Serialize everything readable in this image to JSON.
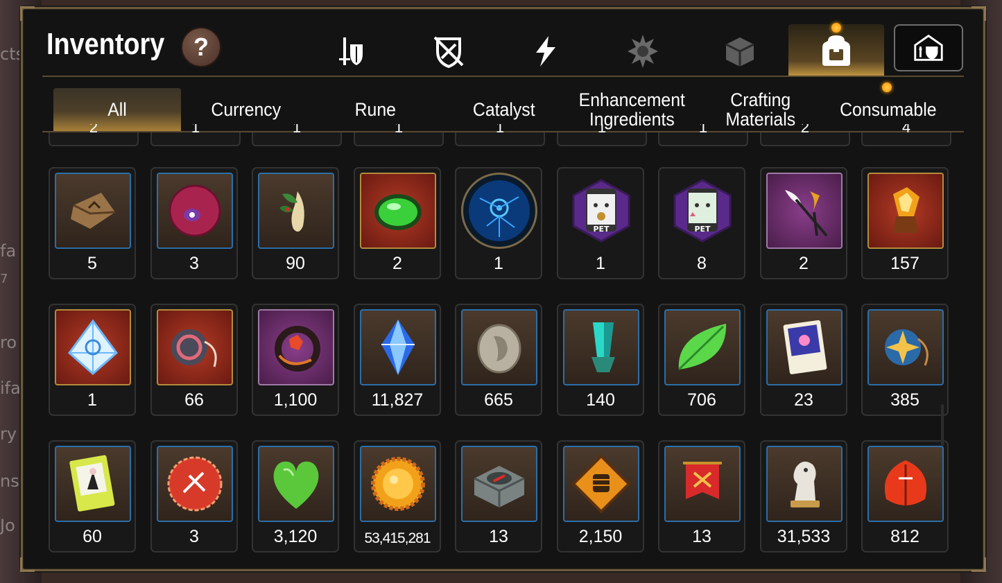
{
  "header": {
    "title": "Inventory",
    "help_label": "?"
  },
  "category_tabs": [
    {
      "icon": "sword-shield-icon",
      "active": false
    },
    {
      "icon": "broken-shield-icon",
      "active": false
    },
    {
      "icon": "lightning-icon",
      "active": false
    },
    {
      "icon": "spiked-artifact-icon",
      "active": false
    },
    {
      "icon": "cube-icon",
      "active": false
    },
    {
      "icon": "backpack-icon",
      "active": true
    }
  ],
  "guild_button_icon": "guild-storage-icon",
  "sub_tabs": [
    {
      "label": "All",
      "active": true
    },
    {
      "label": "Currency",
      "active": false
    },
    {
      "label": "Rune",
      "active": false
    },
    {
      "label": "Catalyst",
      "active": false
    },
    {
      "label": "Enhancement Ingredients",
      "active": false
    },
    {
      "label": "Crafting Materials",
      "active": false
    },
    {
      "label": "Consumable",
      "active": false
    }
  ],
  "items": [
    [
      {
        "icon": "pouch-icon",
        "qty": "5"
      },
      {
        "icon": "purple-eye-orb-icon",
        "qty": "3"
      },
      {
        "icon": "ginseng-root-icon",
        "qty": "90"
      },
      {
        "icon": "green-potion-icon",
        "qty": "2"
      },
      {
        "icon": "blue-portal-icon",
        "qty": "1"
      },
      {
        "icon": "pet-pack-cat-icon",
        "qty": "1"
      },
      {
        "icon": "pet-pack-icon",
        "qty": "8"
      },
      {
        "icon": "feather-wand-icon",
        "qty": "2"
      },
      {
        "icon": "flame-crystal-icon",
        "qty": "157"
      }
    ],
    [
      {
        "icon": "blue-prism-icon",
        "qty": "1"
      },
      {
        "icon": "gear-amulet-icon",
        "qty": "66"
      },
      {
        "icon": "red-flower-ring-icon",
        "qty": "1,100"
      },
      {
        "icon": "blue-crystal-icon",
        "qty": "11,827"
      },
      {
        "icon": "silver-coin-icon",
        "qty": "665"
      },
      {
        "icon": "teal-crystal-icon",
        "qty": "140"
      },
      {
        "icon": "green-leaf-icon",
        "qty": "706"
      },
      {
        "icon": "star-card-icon",
        "qty": "23"
      },
      {
        "icon": "star-amulet-icon",
        "qty": "385"
      }
    ],
    [
      {
        "icon": "character-card-icon",
        "qty": "60"
      },
      {
        "icon": "red-badge-icon",
        "qty": "3"
      },
      {
        "icon": "green-heart-icon",
        "qty": "3,120"
      },
      {
        "icon": "gold-coin-icon",
        "qty": "53,415,281"
      },
      {
        "icon": "stone-compass-icon",
        "qty": "13"
      },
      {
        "icon": "fist-emblem-icon",
        "qty": "2,150"
      },
      {
        "icon": "red-banner-icon",
        "qty": "13"
      },
      {
        "icon": "knight-chess-icon",
        "qty": "31,533"
      },
      {
        "icon": "red-leaf-icon",
        "qty": "812"
      }
    ]
  ],
  "partial_row_stubs": [
    "2",
    "1",
    "1",
    "1",
    "1",
    "1",
    "1",
    "2",
    "4"
  ],
  "background_text": [
    "cts",
    "fa",
    "7",
    "ro J",
    "ifa",
    "ry",
    "ns",
    "Jo",
    "ts"
  ]
}
